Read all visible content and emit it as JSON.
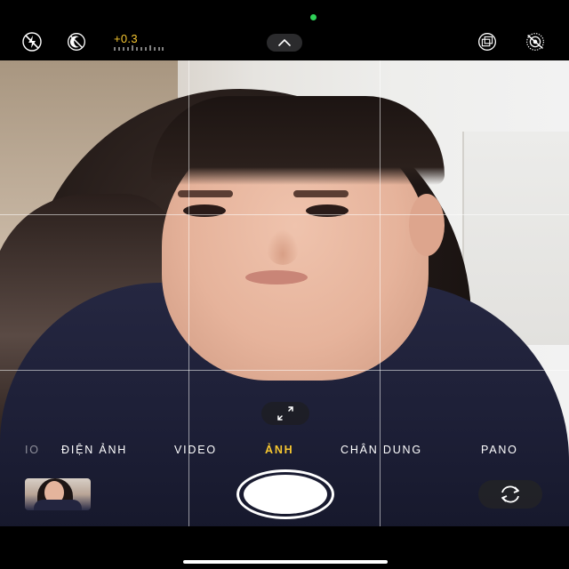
{
  "status": {
    "privacy_indicator_color": "#2fd158"
  },
  "topbar": {
    "flash_icon": "flash-off-icon",
    "live_photo_icon": "live-photo-off-icon",
    "exposure_value": "+0.3",
    "exposure_color": "#f7c730",
    "chevron_icon": "chevron-up-icon",
    "aspect_icon": "stack-layers-icon",
    "live_toggle_icon": "live-off-icon"
  },
  "viewfinder": {
    "grid": "on",
    "zoom_icon": "expand-arrows-icon"
  },
  "modes": {
    "items": [
      {
        "label": "IO",
        "state": "faded"
      },
      {
        "label": "ĐIỆN ẢNH",
        "state": "normal"
      },
      {
        "label": "VIDEO",
        "state": "normal"
      },
      {
        "label": "ẢNH",
        "state": "active"
      },
      {
        "label": "CHÂN DUNG",
        "state": "normal"
      },
      {
        "label": "PANO",
        "state": "normal"
      }
    ],
    "active_color": "#f7c730"
  },
  "controls": {
    "thumbnail": "last-photo-thumbnail",
    "shutter": "shutter-button",
    "flip_icon": "flip-camera-icon"
  }
}
